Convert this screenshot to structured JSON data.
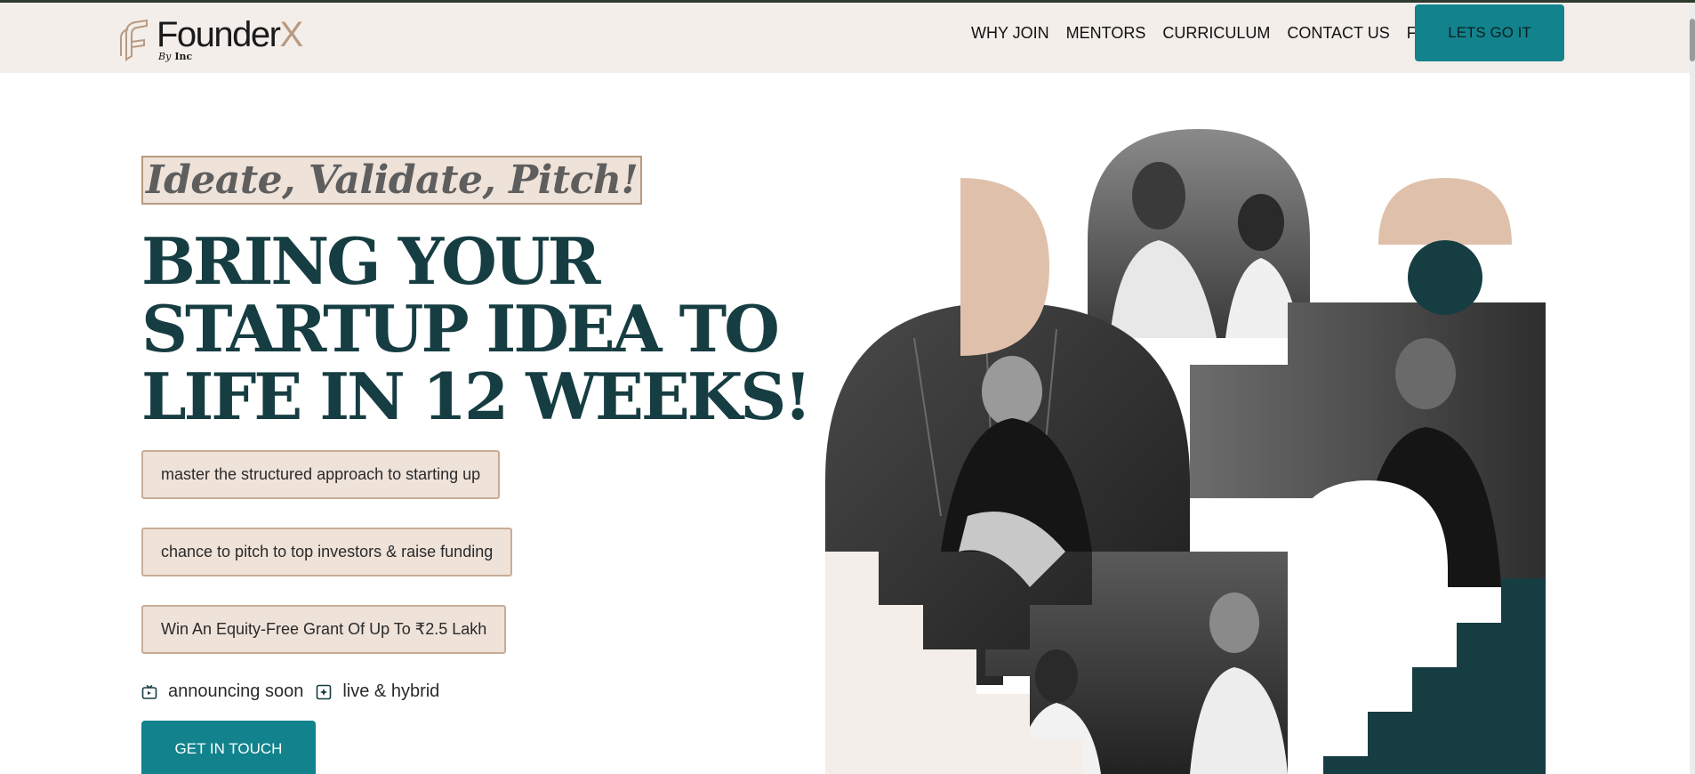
{
  "brand": {
    "name": "Founder",
    "name_accent": "X",
    "byline_by": "By",
    "byline_company": "Inc"
  },
  "nav": {
    "items": [
      {
        "label": "WHY JOIN"
      },
      {
        "label": "MENTORS"
      },
      {
        "label": "CURRICULUM"
      },
      {
        "label": "CONTACT US"
      },
      {
        "label": "FAQ"
      }
    ],
    "cta_label": "LETS GO IT"
  },
  "hero": {
    "tagline": "Ideate, Validate, Pitch!",
    "headline_lines": [
      "BRING YOUR",
      "STARTUP IDEA TO",
      "LIFE IN 12 WEEKS!"
    ],
    "benefits": [
      "master the structured approach to starting up",
      "chance to pitch to top investors & raise funding",
      "Win An Equity-Free Grant Of Up To ₹2.5 Lakh"
    ],
    "meta": {
      "schedule": "announcing soon",
      "format": "live & hybrid"
    },
    "cta_label": "GET IN TOUCH"
  },
  "colors": {
    "header_bg": "#f3eeea",
    "teal_button": "#12838d",
    "dark_teal": "#163d42",
    "beige": "#eee2d9",
    "peach": "#dfc1ab"
  }
}
